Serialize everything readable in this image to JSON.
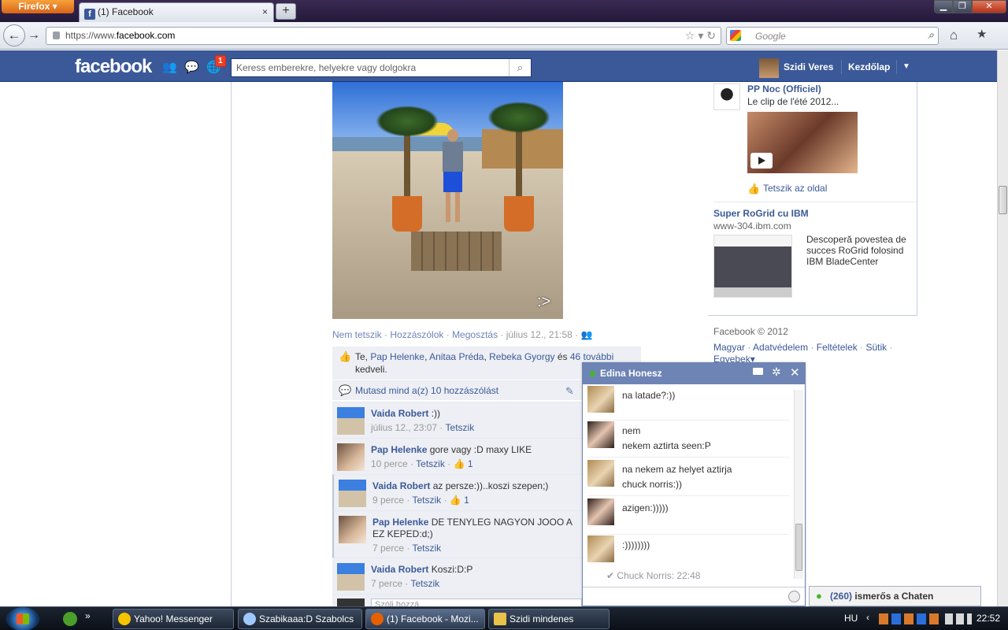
{
  "browser": {
    "menu_label": "Firefox",
    "tab_title": "(1) Facebook",
    "tab_favicon": "f",
    "tab_close": "×",
    "new_tab": "+",
    "url_protocol": "https://www.",
    "url_host": "facebook.com",
    "url_icons": "☆ ▾ ↻",
    "search_placeholder": "Google",
    "win_min": "▁",
    "win_max": "❐",
    "win_close": "✕"
  },
  "fb": {
    "logo": "facebook",
    "notification_count": "1",
    "search_placeholder": "Keress emberekre, helyekre vagy dolgokra",
    "user_name": "Szidi Veres",
    "home_label": "Kezdőlap"
  },
  "post": {
    "actions": {
      "unlike": "Nem tetszik",
      "comment": "Hozzászólok",
      "share": "Megosztás",
      "separator": " · ",
      "timestamp": "július 12., 21:58"
    },
    "likes": {
      "you": "Te, ",
      "names": [
        "Pap Helenke",
        "Anitaa Préda",
        "Rebeka Gyorgy"
      ],
      "and": " és ",
      "others": "46 további",
      "suffix": " kedveli."
    },
    "show_all_comments": "Mutasd mind a(z) 10 hozzászólást",
    "comments": [
      {
        "name": "Vaida Robert",
        "text": " :))",
        "time": "július 12., 23:07",
        "like_label": "Tetszik",
        "likes": ""
      },
      {
        "name": "Pap Helenke",
        "text": " gore vagy :D maxy LIKE",
        "time": "10 perce",
        "like_label": "Tetszik",
        "likes": "1"
      },
      {
        "name": "Vaida Robert",
        "text": " az persze:))..koszi szepen;)",
        "time": "9 perce",
        "like_label": "Tetszik",
        "likes": "1"
      },
      {
        "name": "Pap Helenke",
        "text": " DE TENYLEG NAGYON JOOO A EZ KEPED:d;)",
        "time": "7 perce",
        "like_label": "Tetszik",
        "likes": ""
      },
      {
        "name": "Vaida Robert",
        "text": " Koszi:D:P",
        "time": "7 perce",
        "like_label": "Tetszik",
        "likes": ""
      }
    ],
    "comment_placeholder": "Szólj hozzá..."
  },
  "ads": {
    "page_title": "PP Noc (Officiel)",
    "page_text": "Le clip de l'été 2012...",
    "page_like": "Tetszik az oldal",
    "ibm_title": "Super RoGrid cu IBM",
    "ibm_url": "www-304.ibm.com",
    "ibm_text": "Descoperă povestea de succes RoGrid folosind IBM BladeCenter"
  },
  "footer": {
    "copyright": "Facebook © 2012",
    "links": [
      "Magyar",
      "Adatvédelem",
      "Feltételek",
      "Sütik",
      "Egyebek"
    ]
  },
  "chat": {
    "contact": "Edina Honesz",
    "messages": [
      {
        "from": "Edina",
        "lines": [
          "na latade?:))"
        ]
      },
      {
        "from": "Szidi",
        "lines": [
          "nem",
          "nekem aztirta seen:P"
        ]
      },
      {
        "from": "Edina",
        "lines": [
          "na nekem az helyet aztirja",
          "chuck norris:))"
        ]
      },
      {
        "from": "Szidi",
        "lines": [
          "azigen:)))))"
        ]
      },
      {
        "from": "Edina",
        "lines": [
          ":))))))))"
        ]
      }
    ],
    "seen": "Chuck Norris: 22:48",
    "online_count": "(260)",
    "online_label": " ismerős a Chaten"
  },
  "taskbar": {
    "tasks": [
      "Yahoo! Messenger",
      "Szabikaaa:D Szabolcs",
      "(1) Facebook - Mozi...",
      "Szidi mindenes"
    ],
    "more": "»",
    "lang": "HU",
    "clock": "22:52"
  },
  "colors": {
    "fb_blue": "#3b5998",
    "chat_header": "#6d84b4",
    "online_green": "#42b72a",
    "notif_red": "#f03d25"
  }
}
